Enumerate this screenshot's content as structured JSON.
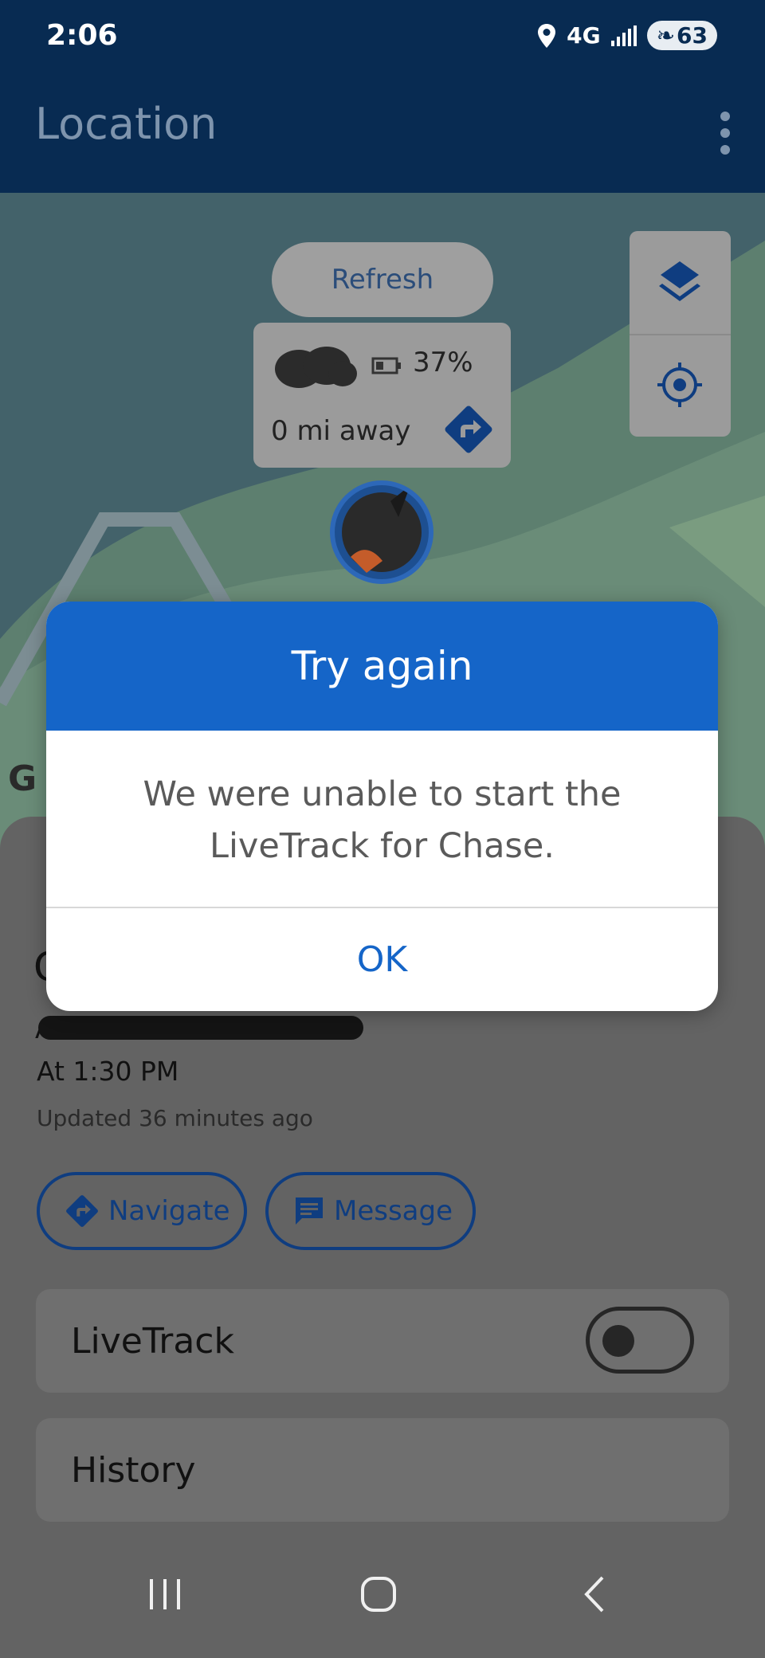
{
  "status_bar": {
    "time": "2:06",
    "network": "4G",
    "battery": "63"
  },
  "app_bar": {
    "title": "Location"
  },
  "map": {
    "refresh_label": "Refresh",
    "battery_percent": "37%",
    "distance": "0 mi away",
    "attribution_mark": "G"
  },
  "sheet": {
    "name_initial": "C",
    "address": "A  l D  C   R  d",
    "at_time": "At 1:30 PM",
    "updated": "Updated 36 minutes ago",
    "navigate_label": "Navigate",
    "message_label": "Message",
    "livetrack_label": "LiveTrack",
    "livetrack_on": false,
    "history_label": "History"
  },
  "dialog": {
    "title": "Try again",
    "message": "We were unable to start the LiveTrack for Chase.",
    "ok_label": "OK"
  },
  "colors": {
    "primary_dark": "#082b52",
    "dialog_header": "#1565c8",
    "button_outline": "#0f3d80"
  }
}
